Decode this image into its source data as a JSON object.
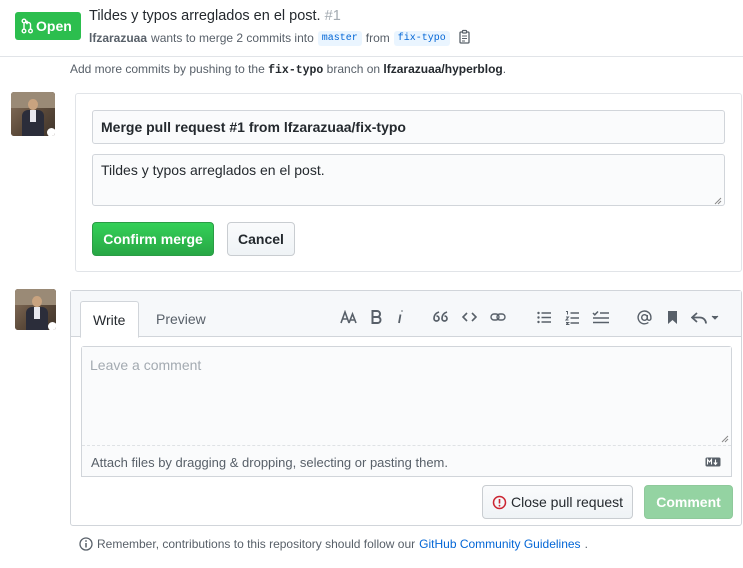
{
  "header": {
    "state_label": "Open",
    "title": "Tildes y typos arreglados en el post.",
    "number": "#1",
    "author": "lfzarazuaa",
    "meta_text": "wants to merge 2 commits into",
    "base_branch": "master",
    "from_text": "from",
    "head_branch": "fix-typo"
  },
  "push_hint": {
    "prefix": "Add more commits by pushing to the",
    "branch": "fix-typo",
    "middle": "branch on",
    "repo": "lfzarazuaa/hyperblog",
    "suffix": "."
  },
  "merge": {
    "title_value": "Merge pull request #1 from lfzarazuaa/fix-typo",
    "body_value": "Tildes y typos arreglados en el post.",
    "confirm_label": "Confirm merge",
    "cancel_label": "Cancel"
  },
  "comment": {
    "tabs": [
      "Write",
      "Preview"
    ],
    "placeholder": "Leave a comment",
    "attach_text": "Attach files by dragging & dropping, selecting or pasting them.",
    "close_label": "Close pull request",
    "submit_label": "Comment",
    "toolbar_icons": [
      "text-size-icon",
      "bold-icon",
      "italic-icon",
      "quote-icon",
      "code-icon",
      "link-icon",
      "unordered-list-icon",
      "ordered-list-icon",
      "task-list-icon",
      "mention-icon",
      "saved-reply-icon",
      "reply-icon"
    ]
  },
  "footer": {
    "prefix": "Remember, contributions to this repository should follow our",
    "link": "GitHub Community Guidelines",
    "suffix": "."
  },
  "colors": {
    "open_green": "#2cbe4e",
    "link_blue": "#0366d6",
    "confirm_green": "#28a745",
    "disabled_green": "#94d3a2",
    "close_red": "#cb2431"
  }
}
